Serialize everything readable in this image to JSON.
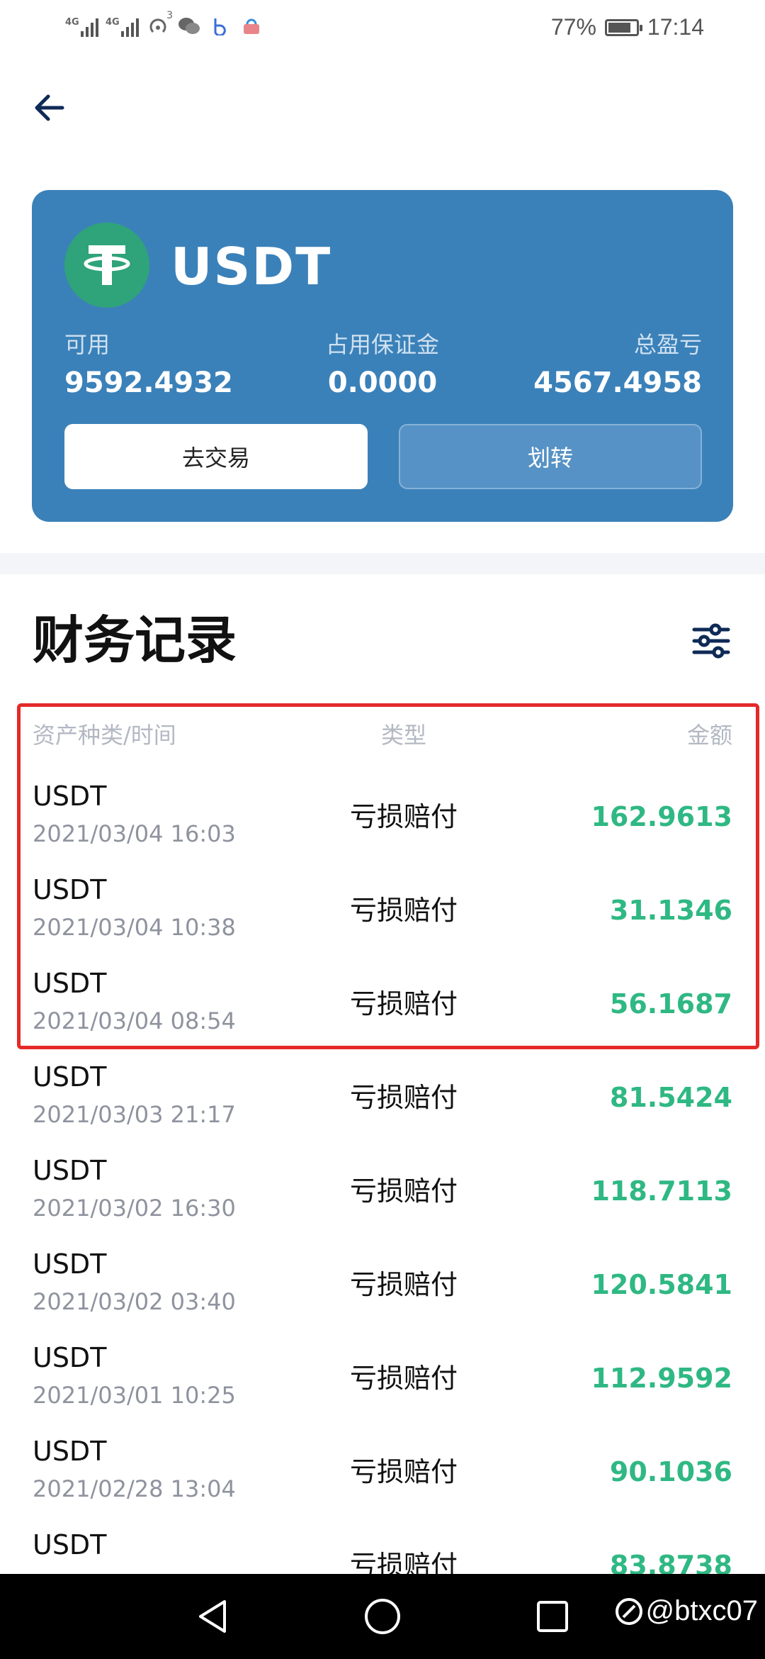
{
  "status_bar": {
    "sim1_label": "4G",
    "sim2_label": "4G",
    "hotspot_count": "3",
    "battery": "77%",
    "time": "17:14"
  },
  "card": {
    "coin": "USDT",
    "available_label": "可用",
    "available_value": "9592.4932",
    "margin_label": "占用保证金",
    "margin_value": "0.0000",
    "pnl_label": "总盈亏",
    "pnl_value": "4567.4958",
    "trade_button": "去交易",
    "transfer_button": "划转"
  },
  "records": {
    "title": "财务记录",
    "headers": {
      "asset_time": "资产种类/时间",
      "type": "类型",
      "amount": "金额"
    },
    "rows": [
      {
        "asset": "USDT",
        "time": "2021/03/04 16:03",
        "type": "亏损赔付",
        "amount": "162.9613"
      },
      {
        "asset": "USDT",
        "time": "2021/03/04 10:38",
        "type": "亏损赔付",
        "amount": "31.1346"
      },
      {
        "asset": "USDT",
        "time": "2021/03/04 08:54",
        "type": "亏损赔付",
        "amount": "56.1687"
      },
      {
        "asset": "USDT",
        "time": "2021/03/03 21:17",
        "type": "亏损赔付",
        "amount": "81.5424"
      },
      {
        "asset": "USDT",
        "time": "2021/03/02 16:30",
        "type": "亏损赔付",
        "amount": "118.7113"
      },
      {
        "asset": "USDT",
        "time": "2021/03/02 03:40",
        "type": "亏损赔付",
        "amount": "120.5841"
      },
      {
        "asset": "USDT",
        "time": "2021/03/01 10:25",
        "type": "亏损赔付",
        "amount": "112.9592"
      },
      {
        "asset": "USDT",
        "time": "2021/02/28 13:04",
        "type": "亏损赔付",
        "amount": "90.1036"
      },
      {
        "asset": "USDT",
        "time": "",
        "type": "亏损赔付",
        "amount": "83.8738"
      }
    ]
  },
  "watermark": "@btxc07",
  "colors": {
    "card_bg": "#3b81b9",
    "amount_green": "#2fb883",
    "highlight_red": "#e5292a",
    "coin_logo_green": "#2fa37a"
  },
  "icons": {
    "back": "arrow-left-icon",
    "filter": "sliders-icon",
    "coin": "tether-icon"
  }
}
